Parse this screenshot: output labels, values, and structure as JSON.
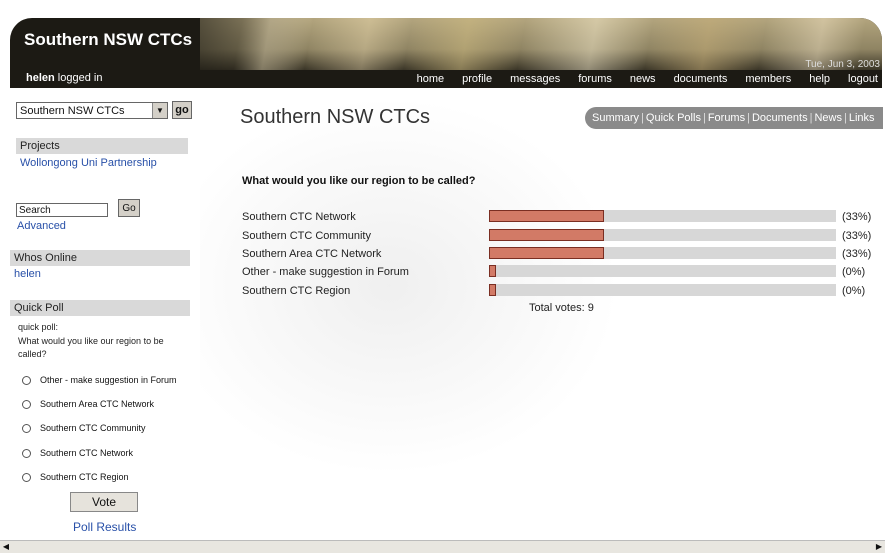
{
  "header": {
    "title": "Southern NSW CTCs",
    "user": "helen",
    "logged_text": "logged in",
    "date": "Tue, Jun 3, 2003",
    "nav": [
      "home",
      "profile",
      "messages",
      "forums",
      "news",
      "documents",
      "members",
      "help",
      "logout"
    ]
  },
  "sidebar": {
    "community_select": "Southern NSW CTCs",
    "go_label": "go",
    "projects_heading": "Projects",
    "project_link": "Wollongong Uni Partnership",
    "search_value": "Search",
    "search_go": "Go",
    "advanced_link": "Advanced",
    "whos_online_heading": "Whos Online",
    "online_user": "helen",
    "quick_poll_heading": "Quick Poll",
    "poll_label": "quick poll:",
    "poll_question": "What would you like our region to be called?",
    "poll_options": [
      "Other - make suggestion in Forum",
      "Southern Area CTC Network",
      "Southern CTC Community",
      "Southern CTC Network",
      "Southern CTC Region"
    ],
    "vote_label": "Vote",
    "poll_results_link": "Poll Results"
  },
  "main": {
    "page_title": "Southern NSW CTCs",
    "tabs": [
      "Summary",
      "Quick Polls",
      "Forums",
      "Documents",
      "News",
      "Links"
    ],
    "question": "What would you like our region to be called?",
    "results": [
      {
        "label": "Southern CTC Network",
        "percent": 33,
        "percent_text": "(33%)"
      },
      {
        "label": "Southern CTC Community",
        "percent": 33,
        "percent_text": "(33%)"
      },
      {
        "label": "Southern Area CTC Network",
        "percent": 33,
        "percent_text": "(33%)"
      },
      {
        "label": "Other - make suggestion in Forum",
        "percent": 0,
        "percent_text": "(0%)"
      },
      {
        "label": "Southern CTC Region",
        "percent": 0,
        "percent_text": "(0%)"
      }
    ],
    "total_votes": "Total votes: 9"
  },
  "colors": {
    "bar_fill": "#d27a66",
    "bar_track": "#d7d7d7",
    "link": "#2850a8",
    "tab_bar": "#8a8a8a"
  }
}
